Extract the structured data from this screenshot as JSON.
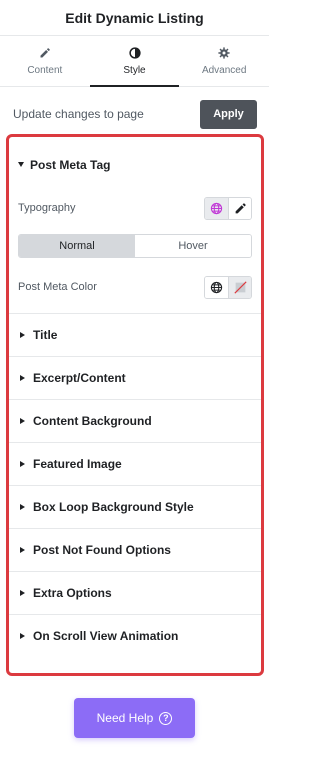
{
  "header": {
    "title": "Edit Dynamic Listing"
  },
  "tabs": [
    {
      "label": "Content",
      "icon": "pencil-icon",
      "active": false
    },
    {
      "label": "Style",
      "icon": "contrast-icon",
      "active": true
    },
    {
      "label": "Advanced",
      "icon": "gear-icon",
      "active": false
    }
  ],
  "update": {
    "text": "Update changes to page",
    "apply_label": "Apply"
  },
  "panel": {
    "open_section": {
      "title": "Post Meta Tag",
      "typography_label": "Typography",
      "states": [
        "Normal",
        "Hover"
      ],
      "selected_state": "Normal",
      "color_label": "Post Meta Color"
    },
    "sections": [
      "Title",
      "Excerpt/Content",
      "Content Background",
      "Featured Image",
      "Box Loop Background Style",
      "Post Not Found Options",
      "Extra Options",
      "On Scroll View Animation"
    ]
  },
  "help": {
    "label": "Need Help",
    "icon": "question-circle-icon"
  },
  "colors": {
    "accent": "#8c6cf6",
    "highlight_border": "#dc3a3f",
    "apply_bg": "#4e535a",
    "globe_active": "#c036d6"
  }
}
